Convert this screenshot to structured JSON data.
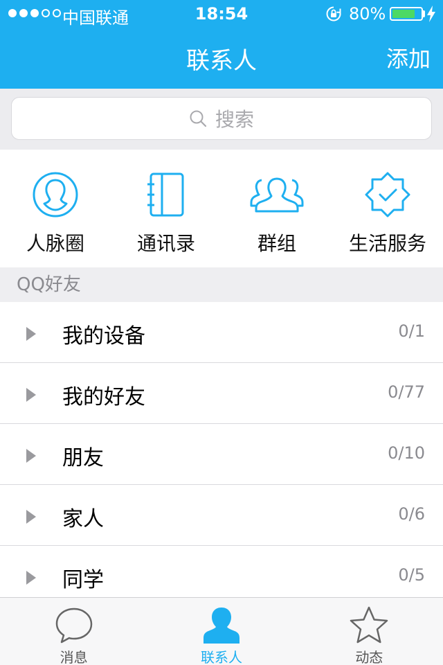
{
  "status_bar": {
    "carrier": "中国联通",
    "time": "18:54",
    "battery_percent": "80%",
    "battery_level": 0.8,
    "signal_dots_filled": 3,
    "signal_dots_total": 5
  },
  "nav": {
    "title": "联系人",
    "add_label": "添加"
  },
  "search": {
    "placeholder": "搜索"
  },
  "quick_access": [
    {
      "label": "人脉圈",
      "icon": "person-circle-icon"
    },
    {
      "label": "通讯录",
      "icon": "address-book-icon"
    },
    {
      "label": "群组",
      "icon": "group-icon"
    },
    {
      "label": "生活服务",
      "icon": "service-badge-icon"
    }
  ],
  "section_title": "QQ好友",
  "groups": [
    {
      "name": "我的设备",
      "count": "0/1"
    },
    {
      "name": "我的好友",
      "count": "0/77"
    },
    {
      "name": "朋友",
      "count": "0/10"
    },
    {
      "name": "家人",
      "count": "0/6"
    },
    {
      "name": "同学",
      "count": "0/5"
    }
  ],
  "tabs": [
    {
      "label": "消息",
      "icon": "chat-bubble-icon",
      "active": false
    },
    {
      "label": "联系人",
      "icon": "contact-person-icon",
      "active": true
    },
    {
      "label": "动态",
      "icon": "star-icon",
      "active": false
    }
  ],
  "colors": {
    "accent": "#1eaff0",
    "battery": "#4cd964"
  }
}
